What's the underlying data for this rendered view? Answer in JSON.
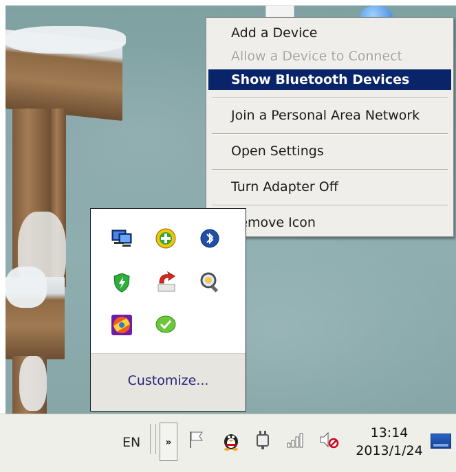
{
  "context_menu": {
    "items": [
      {
        "label": "Add a Device",
        "state": "normal"
      },
      {
        "label": "Allow a Device to Connect",
        "state": "disabled"
      },
      {
        "label": "Show Bluetooth Devices",
        "state": "highlighted"
      },
      {
        "label": "Join a Personal Area Network",
        "state": "normal"
      },
      {
        "label": "Open Settings",
        "state": "normal"
      },
      {
        "label": "Turn Adapter Off",
        "state": "normal"
      },
      {
        "label": "Remove Icon",
        "state": "normal"
      }
    ],
    "highlight_color": "#0a246a"
  },
  "tray_overflow": {
    "icons": [
      "network-monitor-icon",
      "green-plus-icon",
      "bluetooth-icon",
      "green-shield-icon",
      "red-arrow-icon",
      "magnifier-icon",
      "colorful-badge-icon",
      "green-check-icon"
    ],
    "customize_label": "Customize..."
  },
  "taskbar": {
    "language": "EN",
    "chevron_glyph": "»",
    "icons": [
      "flag-icon",
      "qq-penguin-icon",
      "power-plug-icon",
      "signal-bars-icon",
      "volume-muted-icon",
      "show-desktop-icon"
    ],
    "clock_time": "13:14",
    "clock_date": "2013/1/24"
  }
}
